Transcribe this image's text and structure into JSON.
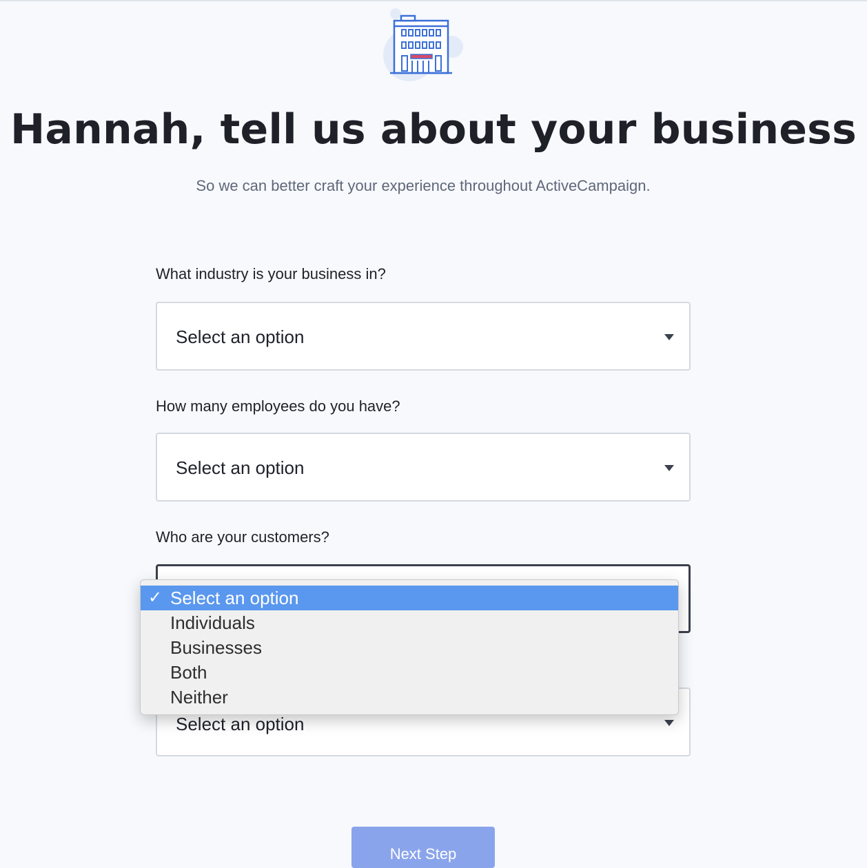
{
  "header": {
    "title": "Hannah, tell us about your business",
    "subtitle": "So we can better craft your experience throughout ActiveCampaign.",
    "icon": "building-icon"
  },
  "questions": [
    {
      "label": "What industry is your business in?",
      "value": "Select an option"
    },
    {
      "label": "How many employees do you have?",
      "value": "Select an option"
    },
    {
      "label": "Who are your customers?",
      "value": "Select an option"
    },
    {
      "label": "",
      "value": "Select an option"
    }
  ],
  "customers_dropdown": {
    "options": [
      {
        "label": "Select an option",
        "selected": true
      },
      {
        "label": "Individuals",
        "selected": false
      },
      {
        "label": "Businesses",
        "selected": false
      },
      {
        "label": "Both",
        "selected": false
      },
      {
        "label": "Neither",
        "selected": false
      }
    ],
    "check_glyph": "✓"
  },
  "next_button": {
    "label": "Next Step"
  },
  "colors": {
    "background": "#f7f9fd",
    "accent": "#3b6fd8",
    "highlight": "#5a97ee",
    "button": "#8aa4ec",
    "stripe": "#d64b6a"
  }
}
